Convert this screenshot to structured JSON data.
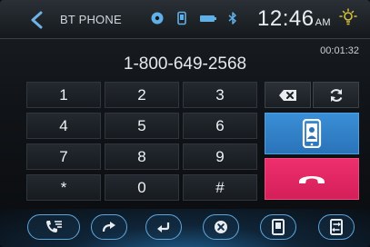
{
  "header": {
    "title": "BT PHONE",
    "clock": "12:46",
    "clock_suffix": "AM"
  },
  "call": {
    "number": "1-800-649-2568",
    "duration": "00:01:32"
  },
  "keypad": {
    "keys": [
      "1",
      "2",
      "3",
      "4",
      "5",
      "6",
      "7",
      "8",
      "9",
      "*",
      "0",
      "#"
    ]
  },
  "icons": {
    "back": "chevron-left-icon",
    "status": [
      "media-icon",
      "phone-status-icon",
      "battery-icon",
      "bluetooth-icon"
    ],
    "weather": "sun-icon",
    "backspace": "backspace-icon",
    "redial": "refresh-icon",
    "contact": "phone-contact-icon",
    "hangup": "hang-up-icon",
    "bottom": [
      "call-log-icon",
      "forward-icon",
      "return-icon",
      "close-icon",
      "phonebook-icon",
      "swap-icon"
    ]
  },
  "colors": {
    "accent": "#3a8fd6",
    "hangup": "#e8286a"
  }
}
